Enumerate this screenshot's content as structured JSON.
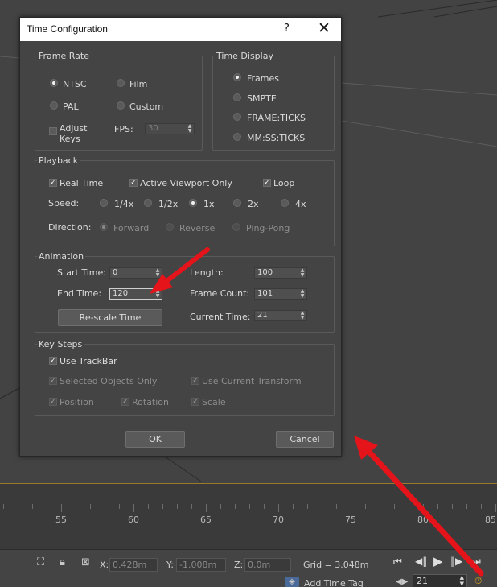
{
  "dialog": {
    "title": "Time Configuration",
    "help": "?",
    "close": "✕",
    "frame_rate": {
      "title": "Frame Rate",
      "options": [
        "NTSC",
        "Film",
        "PAL",
        "Custom"
      ],
      "selected": "NTSC",
      "adjust_keys_line1": "Adjust",
      "adjust_keys_line2": "Keys",
      "adjust_keys_checked": false,
      "fps_label": "FPS:",
      "fps_value": "30"
    },
    "time_display": {
      "title": "Time Display",
      "options": [
        "Frames",
        "SMPTE",
        "FRAME:TICKS",
        "MM:SS:TICKS"
      ],
      "selected": "Frames"
    },
    "playback": {
      "title": "Playback",
      "real_time": "Real Time",
      "active_viewport_only": "Active Viewport Only",
      "loop": "Loop",
      "speed_label": "Speed:",
      "speeds": [
        "1/4x",
        "1/2x",
        "1x",
        "2x",
        "4x"
      ],
      "speed_selected": "1x",
      "direction_label": "Direction:",
      "directions": [
        "Forward",
        "Reverse",
        "Ping-Pong"
      ]
    },
    "animation": {
      "title": "Animation",
      "start_time_label": "Start Time:",
      "start_time": "0",
      "end_time_label": "End Time:",
      "end_time": "120",
      "length_label": "Length:",
      "length": "100",
      "frame_count_label": "Frame Count:",
      "frame_count": "101",
      "current_time_label": "Current Time:",
      "current_time": "21",
      "rescale_button": "Re-scale Time"
    },
    "key_steps": {
      "title": "Key Steps",
      "use_trackbar": "Use TrackBar",
      "selected_objects_only": "Selected Objects Only",
      "use_current_transform": "Use Current Transform",
      "position": "Position",
      "rotation": "Rotation",
      "scale": "Scale"
    },
    "ok_button": "OK",
    "cancel_button": "Cancel"
  },
  "timeline": {
    "ticks": [
      55,
      60,
      65,
      70,
      75,
      80,
      85
    ]
  },
  "statusbar": {
    "x_label": "X:",
    "x_value": "0.428m",
    "y_label": "Y:",
    "y_value": "-1.008m",
    "z_label": "Z:",
    "z_value": "0.0m",
    "grid": "Grid = 3.048m",
    "add_time_tag": "Add Time Tag",
    "current_frame": "21"
  },
  "colors": {
    "annotation_arrow": "#e5141b",
    "timeline_border": "#9a7a2a"
  }
}
